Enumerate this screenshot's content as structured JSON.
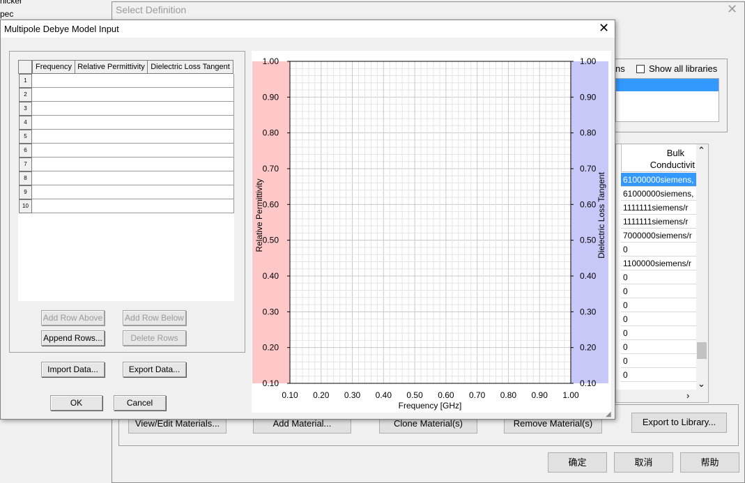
{
  "background_window": {
    "title": "Select Definition",
    "show_all_libraries": "Show all libraries",
    "partial_label": "ns",
    "col_bulk": "Bulk",
    "col_conductivity": "Conductivit",
    "conductivity_values": [
      "61000000siemens,",
      "61000000siemens,",
      "1111111siemens/r",
      "1111111siemens/r",
      "7000000siemens/r",
      "0",
      "1100000siemens/r",
      "0",
      "0",
      "0",
      "0",
      "0",
      "0",
      "0",
      "0"
    ],
    "buttons": {
      "view_edit": "View/Edit Materials...",
      "add_material": "Add Material...",
      "clone_material": "Clone Material(s)",
      "remove_material": "Remove Material(s)",
      "export_library": "Export to Library...",
      "ok": "确定",
      "cancel": "取消",
      "help": "帮助"
    },
    "left_edge_text": [
      "hicker",
      "pec"
    ]
  },
  "dialog": {
    "title": "Multipole Debye Model Input",
    "table": {
      "headers": [
        "Frequency",
        "Relative Permittivity",
        "Dielectric Loss Tangent"
      ],
      "row_numbers": [
        "1",
        "2",
        "3",
        "4",
        "5",
        "6",
        "7",
        "8",
        "9",
        "10"
      ]
    },
    "buttons": {
      "add_row_above": "Add Row Above",
      "add_row_below": "Add Row Below",
      "append_rows": "Append Rows...",
      "delete_rows": "Delete Rows",
      "import_data": "Import Data...",
      "export_data": "Export Data...",
      "ok": "OK",
      "cancel": "Cancel"
    }
  },
  "chart_data": {
    "type": "line",
    "xlabel": "Frequency [GHz]",
    "ylabel_left": "Relative Permittivity",
    "ylabel_right": "Dielectric Loss Tangent",
    "xlim": [
      0.1,
      1.0
    ],
    "ylim_left": [
      0.1,
      1.0
    ],
    "ylim_right": [
      0.1,
      1.0
    ],
    "x_ticks": [
      "0.10",
      "0.20",
      "0.30",
      "0.40",
      "0.50",
      "0.60",
      "0.70",
      "0.80",
      "0.90",
      "1.00"
    ],
    "y_ticks": [
      "0.10",
      "0.20",
      "0.30",
      "0.40",
      "0.50",
      "0.60",
      "0.70",
      "0.80",
      "0.90",
      "1.00"
    ],
    "grid": true,
    "series": [],
    "colors": {
      "left_band": "#ffc8c8",
      "right_band": "#c8c8f8",
      "grid_minor": "#e4e4e4",
      "grid_major": "#c8c8c8"
    }
  }
}
